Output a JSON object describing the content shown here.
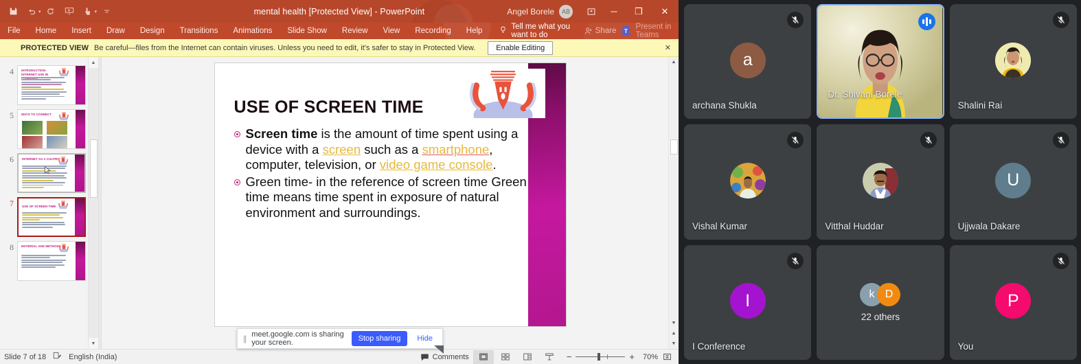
{
  "powerpoint": {
    "title_bar": {
      "document_title": "mental health [Protected View]  -  PowerPoint",
      "account_name": "Angel Borele",
      "account_initials": "AB",
      "quick_access": [
        {
          "name": "save",
          "icon": "save-icon"
        },
        {
          "name": "undo",
          "icon": "undo-icon"
        },
        {
          "name": "redo",
          "icon": "redo-icon"
        },
        {
          "name": "start-from-beginning",
          "icon": "slideshow-icon"
        },
        {
          "name": "touch-mouse-mode",
          "icon": "touch-mode-icon"
        },
        {
          "name": "customize-quick-access",
          "icon": "more-icon"
        }
      ],
      "window_buttons": {
        "ribbon_display": "ribbon-display-options-icon",
        "minimize": "─",
        "maximize": "❐",
        "close": "✕"
      }
    },
    "ribbon": {
      "tabs": [
        "File",
        "Home",
        "Insert",
        "Draw",
        "Design",
        "Transitions",
        "Animations",
        "Slide Show",
        "Review",
        "View",
        "Recording",
        "Help"
      ],
      "tell_me": "Tell me what you want to do",
      "share_label": "Share",
      "present_in_teams": "Present in Teams",
      "teams_badge": "T"
    },
    "protected_view": {
      "label": "PROTECTED VIEW",
      "message": "Be careful—files from the Internet can contain viruses. Unless you need to edit, it's safer to stay in Protected View.",
      "enable_button": "Enable Editing",
      "close": "✕"
    },
    "thumbnails": [
      {
        "number": "4",
        "title": "INTRODUCTION-\nINTERNET USE IN PANDEMIC",
        "selected": false,
        "type": "text"
      },
      {
        "number": "5",
        "title": "WAYS TO CONNECT",
        "selected": false,
        "type": "photos"
      },
      {
        "number": "6",
        "title": "INTERNET AS A CULPRIT",
        "selected": false,
        "type": "text",
        "hover": true
      },
      {
        "number": "7",
        "title": "USE OF  SCREEN TIME",
        "selected": true,
        "type": "text"
      },
      {
        "number": "8",
        "title": "MATERIAL AND METHODS",
        "selected": false,
        "type": "text"
      }
    ],
    "slide": {
      "title": "USE OF SCREEN TIME",
      "bullets": [
        {
          "segments": [
            {
              "text": "Screen time",
              "style": "bold"
            },
            {
              "text": " is the amount of time spent using a device with a ",
              "style": "normal"
            },
            {
              "text": "screen",
              "style": "link"
            },
            {
              "text": " such as a ",
              "style": "normal"
            },
            {
              "text": "smartphone",
              "style": "link-red"
            },
            {
              "text": ", computer, television, or ",
              "style": "normal"
            },
            {
              "text": "video game console",
              "style": "link"
            },
            {
              "text": ".",
              "style": "normal"
            }
          ]
        },
        {
          "segments": [
            {
              "text": "Green time-  in the reference of screen time Green time means time spent in exposure of natural environment and surroundings.",
              "style": "normal"
            }
          ]
        }
      ]
    },
    "sharing_toast": {
      "message": "meet.google.com is sharing your screen.",
      "stop_button": "Stop sharing",
      "hide_button": "Hide"
    },
    "status_bar": {
      "slide_counter": "Slide 7 of 18",
      "accessibility_icon": "accessibility-icon",
      "language": "English (India)",
      "comments_label": "Comments",
      "views": [
        {
          "name": "normal-view",
          "icon": "normal-view-icon",
          "active": true
        },
        {
          "name": "slide-sorter-view",
          "icon": "slide-sorter-icon",
          "active": false
        },
        {
          "name": "reading-view",
          "icon": "reading-view-icon",
          "active": false
        },
        {
          "name": "slide-show-view",
          "icon": "slide-show-icon",
          "active": false
        }
      ],
      "zoom_out": "−",
      "zoom_in": "+",
      "zoom_level": "70%",
      "fit_to_window": "fit-slide-icon"
    },
    "colors": {
      "title_bar": "#b7472a",
      "ribbon": "#c0492b",
      "protected_bar": "#fcf8b8",
      "selected_thumb_border": "#a41b1b",
      "slide_accent": "#c2189a"
    }
  },
  "meet": {
    "participants": [
      {
        "name": "archana Shukla",
        "avatar_type": "initial",
        "initial": "a",
        "color": "#8d5a44",
        "muted": true,
        "speaking": false
      },
      {
        "name": "Dr. Shivani Borele",
        "avatar_type": "video",
        "muted": false,
        "speaking": true
      },
      {
        "name": "Shalini Rai",
        "avatar_type": "photo",
        "color": "#efeab0",
        "muted": true,
        "speaking": false
      },
      {
        "name": "Vishal Kumar",
        "avatar_type": "photo",
        "color": "#d6a53e",
        "muted": true,
        "speaking": false
      },
      {
        "name": "Vitthal Huddar",
        "avatar_type": "photo",
        "color": "#c6c9ab",
        "muted": true,
        "speaking": false
      },
      {
        "name": "Ujjwala Dakare",
        "avatar_type": "initial",
        "initial": "U",
        "color": "#5f7d8c",
        "muted": true,
        "speaking": false
      },
      {
        "name": "I Conference",
        "avatar_type": "initial",
        "initial": "I",
        "color": "#a413cf",
        "muted": true,
        "speaking": false
      },
      {
        "name": "22 others",
        "avatar_type": "group",
        "group": [
          {
            "initial": "k",
            "color": "#8aa1ad"
          },
          {
            "initial": "D",
            "color": "#f28a11"
          }
        ],
        "muted": false,
        "speaking": false
      },
      {
        "name": "You",
        "avatar_type": "initial",
        "initial": "P",
        "color": "#f50a6e",
        "muted": true,
        "speaking": false
      }
    ],
    "colors": {
      "background": "#202124",
      "tile": "#3c4043",
      "speaking_border": "#8ab4f8",
      "speaking_badge": "#1a73e8"
    }
  }
}
